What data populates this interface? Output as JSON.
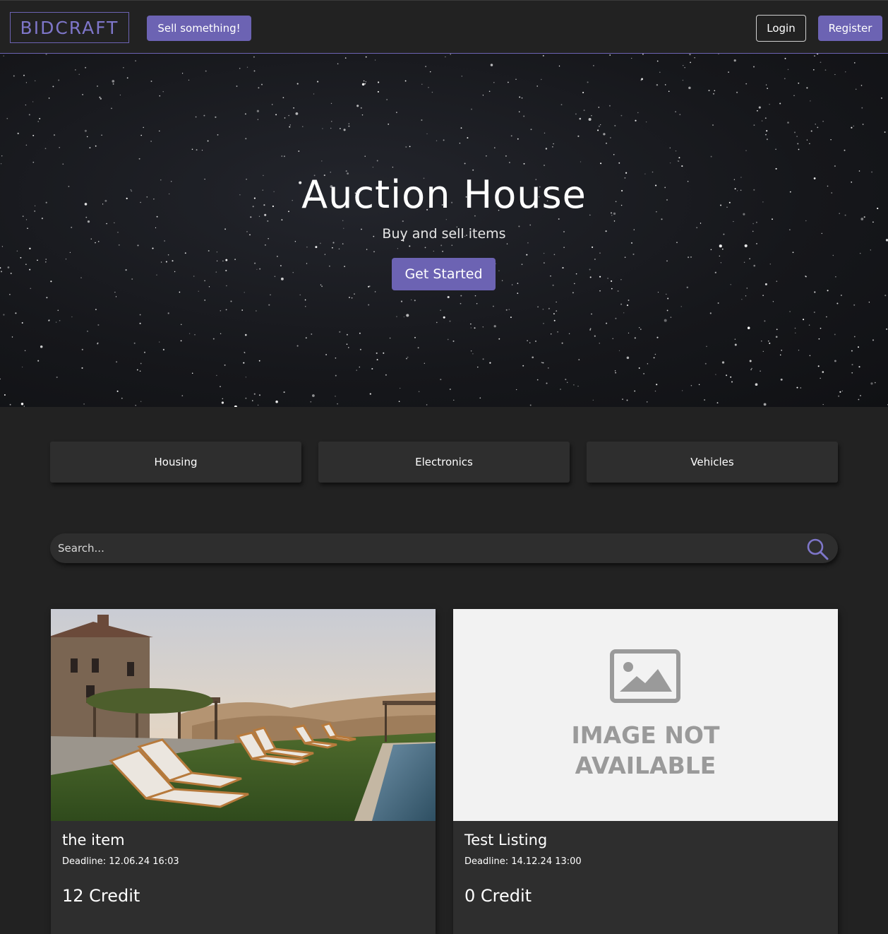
{
  "navbar": {
    "brand": "BIDCRAFT",
    "sell_label": "Sell something!",
    "login_label": "Login",
    "register_label": "Register"
  },
  "hero": {
    "title": "Auction House",
    "subtitle": "Buy and sell items",
    "cta_label": "Get Started"
  },
  "categories": [
    {
      "label": "Housing"
    },
    {
      "label": "Electronics"
    },
    {
      "label": "Vehicles"
    }
  ],
  "search": {
    "placeholder": "Search...",
    "value": ""
  },
  "listings": [
    {
      "title": "the item",
      "deadline": "Deadline: 12.06.24 16:03",
      "price": "12 Credit",
      "image": "villa-poolside-photo"
    },
    {
      "title": "Test Listing",
      "deadline": "Deadline: 14.12.24 13:00",
      "price": "0 Credit",
      "image_placeholder_line1": "IMAGE NOT",
      "image_placeholder_line2": "AVAILABLE"
    }
  ],
  "colors": {
    "accent": "#6c63b3",
    "background": "#222222",
    "surface": "#2e2e2e"
  }
}
